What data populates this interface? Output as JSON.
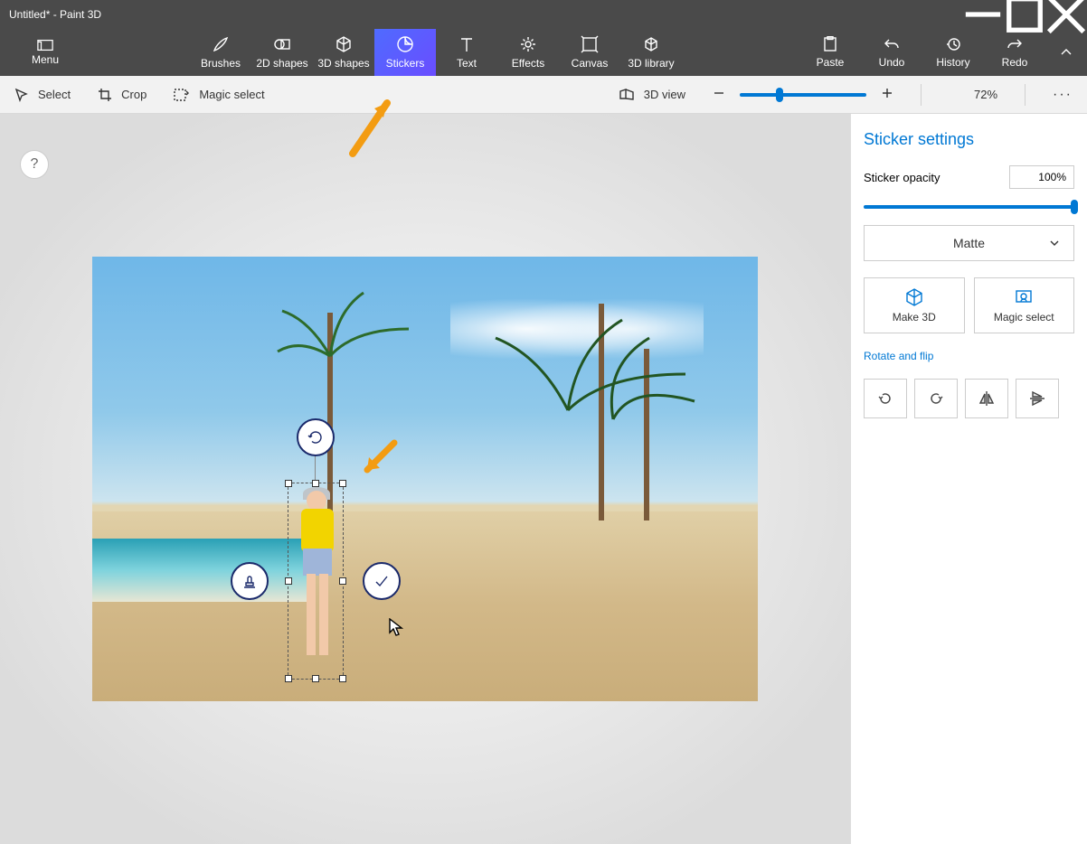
{
  "titlebar": {
    "title": "Untitled* - Paint 3D"
  },
  "menu": {
    "label": "Menu"
  },
  "tools": [
    {
      "label": "Brushes",
      "name": "tool-brushes",
      "active": false
    },
    {
      "label": "2D shapes",
      "name": "tool-2d-shapes",
      "active": false
    },
    {
      "label": "3D shapes",
      "name": "tool-3d-shapes",
      "active": false
    },
    {
      "label": "Stickers",
      "name": "tool-stickers",
      "active": true
    },
    {
      "label": "Text",
      "name": "tool-text",
      "active": false
    },
    {
      "label": "Effects",
      "name": "tool-effects",
      "active": false
    },
    {
      "label": "Canvas",
      "name": "tool-canvas",
      "active": false
    },
    {
      "label": "3D library",
      "name": "tool-3d-library",
      "active": false
    }
  ],
  "rightcmds": [
    {
      "label": "Paste",
      "name": "cmd-paste"
    },
    {
      "label": "Undo",
      "name": "cmd-undo"
    },
    {
      "label": "History",
      "name": "cmd-history"
    },
    {
      "label": "Redo",
      "name": "cmd-redo"
    }
  ],
  "subbar": {
    "select": "Select",
    "crop": "Crop",
    "magic_select": "Magic select",
    "view3d": "3D view",
    "zoom_pct": "72%"
  },
  "help": "?",
  "panel": {
    "title": "Sticker settings",
    "opacity_label": "Sticker opacity",
    "opacity_value": "100%",
    "finish": "Matte",
    "make3d": "Make 3D",
    "magic_select": "Magic select",
    "rotate_flip": "Rotate and flip"
  }
}
